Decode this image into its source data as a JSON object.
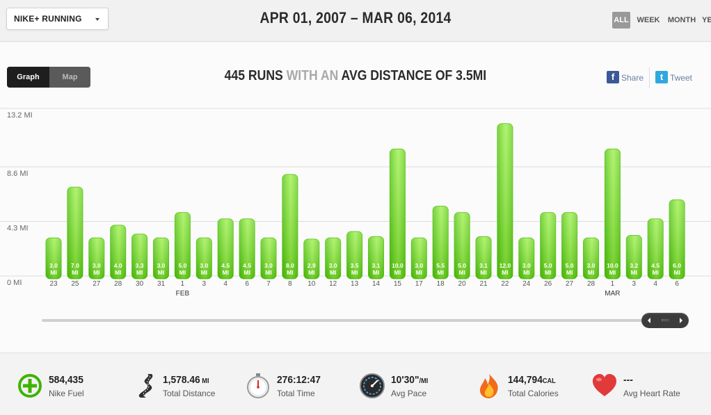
{
  "header": {
    "app_select": "NIKE+ RUNNING",
    "date_range": "APR 01, 2007 – MAR 06, 2014",
    "periods": [
      "ALL",
      "WEEK",
      "MONTH",
      "YEAR"
    ],
    "active_period": "ALL"
  },
  "view_toggle": {
    "graph": "Graph",
    "map": "Map",
    "active": "Graph"
  },
  "summary": {
    "part1": "445 RUNS",
    "part2": " WITH AN ",
    "part3": "AVG DISTANCE OF 3.5MI"
  },
  "share": {
    "facebook": "Share",
    "twitter": "Tweet",
    "facebook_icon": "f",
    "twitter_icon": "t"
  },
  "chart_data": {
    "type": "bar",
    "categories": [
      "23",
      "25",
      "27",
      "28",
      "30",
      "31",
      "1",
      "3",
      "4",
      "6",
      "7",
      "8",
      "10",
      "12",
      "13",
      "14",
      "15",
      "17",
      "18",
      "20",
      "21",
      "22",
      "24",
      "26",
      "27",
      "28",
      "1",
      "3",
      "4",
      "6"
    ],
    "values": [
      3.0,
      7.0,
      3.0,
      4.0,
      3.3,
      3.0,
      5.0,
      3.0,
      4.5,
      4.5,
      3.0,
      8.0,
      2.9,
      3.0,
      3.5,
      3.1,
      10.0,
      3.0,
      5.5,
      5.0,
      3.1,
      12.0,
      3.0,
      5.0,
      5.0,
      3.0,
      10.0,
      3.2,
      4.5,
      6.0
    ],
    "bar_labels": [
      "3.0",
      "7.0",
      "3.0",
      "4.0",
      "3.3",
      "3.0",
      "5.0",
      "3.0",
      "4.5",
      "4.5",
      "3.0",
      "8.0",
      "2.9",
      "3.0",
      "3.5",
      "3.1",
      "10.0",
      "3.0",
      "5.5",
      "5.0",
      "3.1",
      "12.0",
      "3.0",
      "5.0",
      "5.0",
      "3.0",
      "10.0",
      "3.2",
      "4.5",
      "6.0"
    ],
    "bar_unit": "MI",
    "month_labels": [
      {
        "index": 6,
        "label": "FEB"
      },
      {
        "index": 26,
        "label": "MAR"
      }
    ],
    "yticks": [
      {
        "value": 0,
        "label": "0 MI"
      },
      {
        "value": 4.3,
        "label": "4.3 MI"
      },
      {
        "value": 8.6,
        "label": "8.6 MI"
      },
      {
        "value": 13.2,
        "label": "13.2 MI"
      }
    ],
    "ylim": [
      0,
      13.2
    ],
    "colors": {
      "bar_top": "#8fe63a",
      "bar_bottom": "#3fb300",
      "bar_edge": "#52c10c"
    }
  },
  "stats": [
    {
      "name": "nike-fuel",
      "value": "584,435",
      "unit": "",
      "label": "Nike Fuel",
      "icon": "fuel-plus-icon"
    },
    {
      "name": "total-distance",
      "value": "1,578.46",
      "unit": " MI",
      "label": "Total Distance",
      "icon": "road-icon"
    },
    {
      "name": "total-time",
      "value": "276:12:47",
      "unit": "",
      "label": "Total Time",
      "icon": "stopwatch-icon"
    },
    {
      "name": "avg-pace",
      "value": "10'30\"",
      "unit": "/MI",
      "label": "Avg Pace",
      "icon": "speedometer-icon"
    },
    {
      "name": "total-calories",
      "value": "144,794",
      "unit": "CAL",
      "label": "Total Calories",
      "icon": "flame-icon"
    },
    {
      "name": "avg-heart-rate",
      "value": "---",
      "unit": "",
      "label": "Avg Heart Rate",
      "icon": "heart-icon"
    }
  ]
}
